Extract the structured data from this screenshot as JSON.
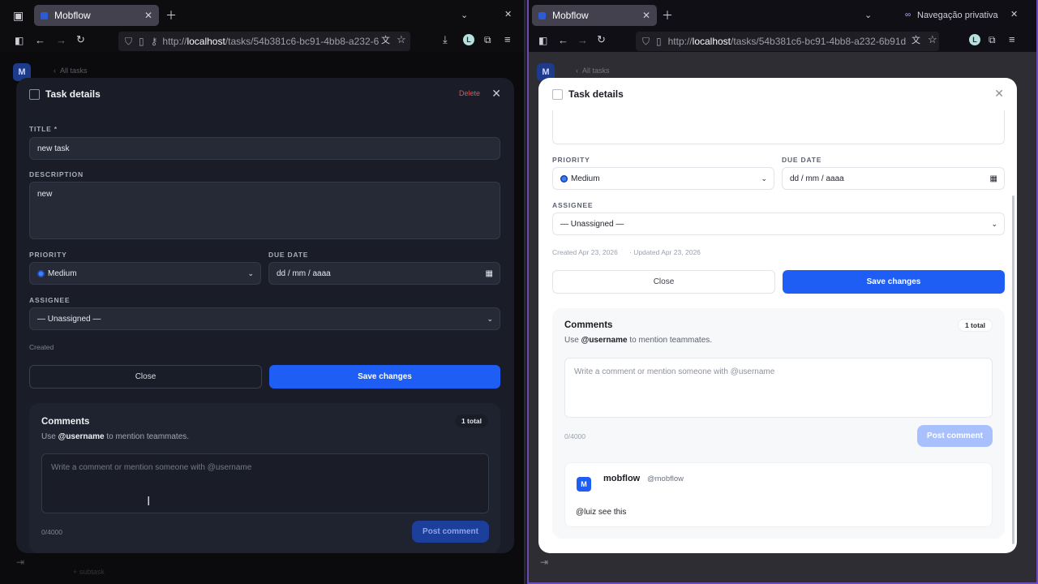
{
  "left": {
    "tab": {
      "title": "Mobflow"
    },
    "url": {
      "prefix": "http://",
      "host": "localhost",
      "path": "/tasks/54b381c6-bc91-4bb8-a232-6"
    },
    "breadcrumb": "All tasks",
    "avatar": "M",
    "bottom_item": "+ subtask",
    "modal": {
      "title": "Task details",
      "delete": "Delete",
      "title_label": "TITLE *",
      "title_value": "new task",
      "description_label": "DESCRIPTION",
      "description_value": "new",
      "priority_label": "PRIORITY",
      "priority_value": "Medium",
      "due_label": "DUE DATE",
      "due_value": "dd / mm / aaaa",
      "assignee_label": "ASSIGNEE",
      "assignee_value": "— Unassigned —",
      "meta": "Created",
      "close": "Close",
      "save": "Save changes",
      "comments": {
        "title": "Comments",
        "hint_pre": "Use ",
        "hint_user": "@username",
        "hint_post": " to mention teammates.",
        "badge": "1 total",
        "placeholder": "Write a comment or mention someone with @username",
        "count": "0/4000",
        "post": "Post comment"
      }
    }
  },
  "right": {
    "tab": {
      "title": "Mobflow"
    },
    "private": "Navegação privativa",
    "url": {
      "prefix": "http://",
      "host": "localhost",
      "path": "/tasks/54b381c6-bc91-4bb8-a232-6b91d"
    },
    "breadcrumb": "All tasks",
    "avatar": "M",
    "modal": {
      "title": "Task details",
      "priority_label": "PRIORITY",
      "priority_value": "Medium",
      "due_label": "DUE DATE",
      "due_value": "dd / mm / aaaa",
      "assignee_label": "ASSIGNEE",
      "assignee_value": "— Unassigned —",
      "meta_created": "Created Apr 23, 2026",
      "meta_updated": "· Updated Apr 23, 2026",
      "close": "Close",
      "save": "Save changes",
      "comments": {
        "title": "Comments",
        "hint_pre": "Use ",
        "hint_user": "@username",
        "hint_post": " to mention teammates.",
        "badge": "1 total",
        "placeholder": "Write a comment or mention someone with @username",
        "count": "0/4000",
        "post": "Post comment",
        "item": {
          "avatar": "M",
          "name": "mobflow",
          "handle": "@mobflow",
          "text": "@luiz see this"
        }
      }
    }
  }
}
